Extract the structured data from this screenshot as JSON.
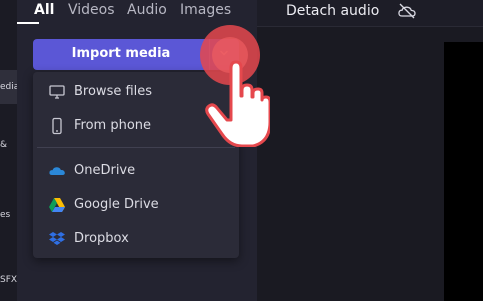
{
  "left_sidebar": {
    "fragments": [
      "edia",
      "&",
      "es",
      "SFX"
    ]
  },
  "tabs": [
    {
      "label": "All",
      "active": true
    },
    {
      "label": "Videos",
      "active": false
    },
    {
      "label": "Audio",
      "active": false
    },
    {
      "label": "Images",
      "active": false
    }
  ],
  "import_button": {
    "label": "Import media"
  },
  "import_menu": {
    "items": [
      {
        "label": "Browse files",
        "icon": "monitor-icon"
      },
      {
        "label": "From phone",
        "icon": "phone-icon"
      },
      {
        "label": "OneDrive",
        "icon": "onedrive-icon"
      },
      {
        "label": "Google Drive",
        "icon": "google-drive-icon"
      },
      {
        "label": "Dropbox",
        "icon": "dropbox-icon"
      }
    ]
  },
  "toolbar": {
    "detach_audio_label": "Detach audio",
    "cloud_icon": "cloud-off-icon"
  },
  "colors": {
    "accent": "#5b57d6",
    "pointer_highlight": "#e5484d",
    "onedrive": "#2b88d8",
    "dropbox": "#2f6fe4"
  }
}
